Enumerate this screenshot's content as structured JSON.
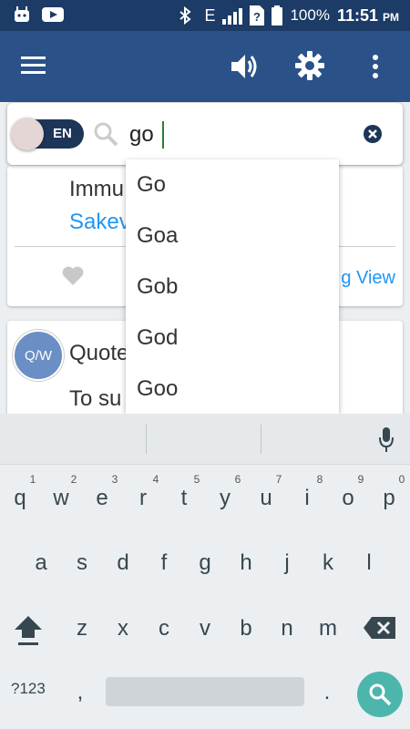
{
  "status_bar": {
    "network": "E",
    "battery": "100%",
    "time": "11:51",
    "ampm": "PM"
  },
  "search": {
    "toggle_label": "EN",
    "query": "go"
  },
  "cards": [
    {
      "title": "Immu",
      "author": "Sakev",
      "link": "g View"
    },
    {
      "avatar": "Q/W",
      "title": "Quote",
      "body": "To su                    take"
    }
  ],
  "suggestions": [
    "Go",
    "Goa",
    "Gob",
    "God",
    "Goo"
  ],
  "keyboard": {
    "row1": [
      {
        "key": "q",
        "hint": "1"
      },
      {
        "key": "w",
        "hint": "2"
      },
      {
        "key": "e",
        "hint": "3"
      },
      {
        "key": "r",
        "hint": "4"
      },
      {
        "key": "t",
        "hint": "5"
      },
      {
        "key": "y",
        "hint": "6"
      },
      {
        "key": "u",
        "hint": "7"
      },
      {
        "key": "i",
        "hint": "8"
      },
      {
        "key": "o",
        "hint": "9"
      },
      {
        "key": "p",
        "hint": "0"
      }
    ],
    "row2": [
      "a",
      "s",
      "d",
      "f",
      "g",
      "h",
      "j",
      "k",
      "l"
    ],
    "row3": [
      "z",
      "x",
      "c",
      "v",
      "b",
      "n",
      "m"
    ],
    "symbols_label": "?123",
    "comma": ",",
    "period": "."
  },
  "colors": {
    "status_bar": "#1c3b66",
    "app_bar": "#2b5288",
    "accent_link": "#2196f3",
    "fab": "#4db6ac"
  },
  "icons": [
    "menu-icon",
    "volume-icon",
    "settings-icon",
    "more-vert-icon",
    "search-icon",
    "clear-icon",
    "heart-icon",
    "mic-icon",
    "shift-icon",
    "backspace-icon",
    "search-fab-icon"
  ]
}
